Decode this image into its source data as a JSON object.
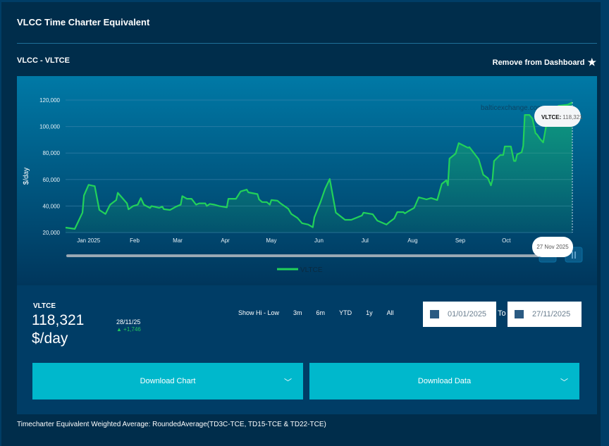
{
  "header": {
    "title": "VLCC Time Charter Equivalent",
    "subtitle": "VLCC - VLTCE",
    "remove_label": "Remove from Dashboard"
  },
  "chart_data": {
    "type": "area",
    "ylabel": "$/day",
    "ylim": [
      20000,
      120000
    ],
    "yticks": [
      "20,000",
      "40,000",
      "60,000",
      "80,000",
      "100,000",
      "120,000"
    ],
    "ytick_values": [
      20000,
      40000,
      60000,
      80000,
      100000,
      120000
    ],
    "xticks": [
      {
        "label": "Jan 2025",
        "date": "2025-01-16"
      },
      {
        "label": "Feb",
        "date": "2025-02-15"
      },
      {
        "label": "Mar",
        "date": "2025-03-15"
      },
      {
        "label": "Apr",
        "date": "2025-04-15"
      },
      {
        "label": "May",
        "date": "2025-05-15"
      },
      {
        "label": "Jun",
        "date": "2025-06-15"
      },
      {
        "label": "Jul",
        "date": "2025-07-15"
      },
      {
        "label": "Aug",
        "date": "2025-08-15"
      },
      {
        "label": "Sep",
        "date": "2025-09-15"
      },
      {
        "label": "Oct",
        "date": "2025-10-15"
      }
    ],
    "xrange": [
      "2025-01-01",
      "2025-11-27"
    ],
    "grid": true,
    "legend": "bottom",
    "watermark": "balticexchange.com",
    "series": [
      {
        "name": "VLTCE",
        "color": "#22d15a",
        "points": [
          [
            "2025-01-01",
            23700
          ],
          [
            "2025-01-07",
            22700
          ],
          [
            "2025-01-12",
            35000
          ],
          [
            "2025-01-13",
            48000
          ],
          [
            "2025-01-16",
            56000
          ],
          [
            "2025-01-20",
            55000
          ],
          [
            "2025-01-23",
            37000
          ],
          [
            "2025-01-27",
            34000
          ],
          [
            "2025-01-30",
            41000
          ],
          [
            "2025-02-03",
            44500
          ],
          [
            "2025-02-04",
            50000
          ],
          [
            "2025-02-10",
            42000
          ],
          [
            "2025-02-11",
            37500
          ],
          [
            "2025-02-14",
            40000
          ],
          [
            "2025-02-17",
            41000
          ],
          [
            "2025-02-19",
            46000
          ],
          [
            "2025-02-21",
            41000
          ],
          [
            "2025-02-25",
            38500
          ],
          [
            "2025-02-26",
            40000
          ],
          [
            "2025-03-03",
            38600
          ],
          [
            "2025-03-05",
            39600
          ],
          [
            "2025-03-06",
            37600
          ],
          [
            "2025-03-10",
            37000
          ],
          [
            "2025-03-14",
            39600
          ],
          [
            "2025-03-17",
            41000
          ],
          [
            "2025-03-18",
            47500
          ],
          [
            "2025-03-21",
            45500
          ],
          [
            "2025-03-24",
            45500
          ],
          [
            "2025-03-27",
            41000
          ],
          [
            "2025-03-29",
            42000
          ],
          [
            "2025-04-02",
            42000
          ],
          [
            "2025-04-03",
            40000
          ],
          [
            "2025-04-05",
            41600
          ],
          [
            "2025-04-08",
            41000
          ],
          [
            "2025-04-11",
            40000
          ],
          [
            "2025-04-16",
            39000
          ],
          [
            "2025-04-17",
            45500
          ],
          [
            "2025-04-22",
            45500
          ],
          [
            "2025-04-25",
            51000
          ],
          [
            "2025-04-29",
            52400
          ],
          [
            "2025-04-30",
            50300
          ],
          [
            "2025-05-06",
            49000
          ],
          [
            "2025-05-07",
            45000
          ],
          [
            "2025-05-09",
            43000
          ],
          [
            "2025-05-12",
            43000
          ],
          [
            "2025-05-14",
            41000
          ],
          [
            "2025-05-15",
            44500
          ],
          [
            "2025-05-19",
            44000
          ],
          [
            "2025-05-21",
            42000
          ],
          [
            "2025-05-26",
            38000
          ],
          [
            "2025-05-28",
            34000
          ],
          [
            "2025-06-01",
            31000
          ],
          [
            "2025-06-04",
            27000
          ],
          [
            "2025-06-08",
            26000
          ],
          [
            "2025-06-11",
            24000
          ],
          [
            "2025-06-12",
            31500
          ],
          [
            "2025-06-16",
            43000
          ],
          [
            "2025-06-19",
            53000
          ],
          [
            "2025-06-22",
            60400
          ],
          [
            "2025-06-26",
            35000
          ],
          [
            "2025-07-02",
            29600
          ],
          [
            "2025-07-06",
            29600
          ],
          [
            "2025-07-13",
            32800
          ],
          [
            "2025-07-14",
            35000
          ],
          [
            "2025-07-20",
            33800
          ],
          [
            "2025-07-23",
            29000
          ],
          [
            "2025-07-29",
            26000
          ],
          [
            "2025-07-31",
            28000
          ],
          [
            "2025-08-03",
            30600
          ],
          [
            "2025-08-05",
            35400
          ],
          [
            "2025-08-09",
            35400
          ],
          [
            "2025-08-10",
            34400
          ],
          [
            "2025-08-12",
            36000
          ],
          [
            "2025-08-16",
            38600
          ],
          [
            "2025-08-19",
            46600
          ],
          [
            "2025-08-24",
            45000
          ],
          [
            "2025-08-27",
            46000
          ],
          [
            "2025-08-31",
            44500
          ],
          [
            "2025-09-03",
            56700
          ],
          [
            "2025-09-06",
            59400
          ],
          [
            "2025-09-07",
            55600
          ],
          [
            "2025-09-08",
            75800
          ],
          [
            "2025-09-12",
            79600
          ],
          [
            "2025-09-14",
            87500
          ],
          [
            "2025-09-20",
            84000
          ],
          [
            "2025-09-21",
            84400
          ],
          [
            "2025-09-27",
            75300
          ],
          [
            "2025-09-30",
            63600
          ],
          [
            "2025-10-03",
            61000
          ],
          [
            "2025-10-05",
            55600
          ],
          [
            "2025-10-06",
            60000
          ],
          [
            "2025-10-07",
            74000
          ],
          [
            "2025-10-11",
            78500
          ],
          [
            "2025-10-13",
            78500
          ],
          [
            "2025-10-14",
            85000
          ],
          [
            "2025-10-18",
            85000
          ],
          [
            "2025-10-20",
            74000
          ],
          [
            "2025-10-21",
            74000
          ],
          [
            "2025-10-22",
            79000
          ],
          [
            "2025-10-25",
            80600
          ],
          [
            "2025-10-26",
            85400
          ],
          [
            "2025-10-27",
            108800
          ],
          [
            "2025-10-30",
            108800
          ],
          [
            "2025-11-01",
            106000
          ],
          [
            "2025-11-03",
            95000
          ],
          [
            "2025-11-04",
            94000
          ],
          [
            "2025-11-06",
            90700
          ],
          [
            "2025-11-08",
            88000
          ],
          [
            "2025-11-10",
            101000
          ],
          [
            "2025-11-18",
            115700
          ],
          [
            "2025-11-24",
            116500
          ],
          [
            "2025-11-27",
            118321
          ]
        ]
      }
    ],
    "tooltip": {
      "label": "VLTCE:",
      "value": "118,321",
      "date": "27 Nov 2025"
    }
  },
  "summary": {
    "label": "VLTCE",
    "value": "118,321",
    "unit": "$/day",
    "date": "28/11/25",
    "change": "+1,746",
    "change_color": "#22c55e"
  },
  "ranges": [
    "Show Hi - Low",
    "3m",
    "6m",
    "YTD",
    "1y",
    "All"
  ],
  "date_range": {
    "from": "01/01/2025",
    "to_label": "To",
    "to": "27/11/2025"
  },
  "buttons": {
    "download_chart": "Download Chart",
    "download_data": "Download Data"
  },
  "footer": "Timecharter Equivalent Weighted Average: RoundedAverage(TD3C-TCE, TD15-TCE & TD22-TCE)"
}
